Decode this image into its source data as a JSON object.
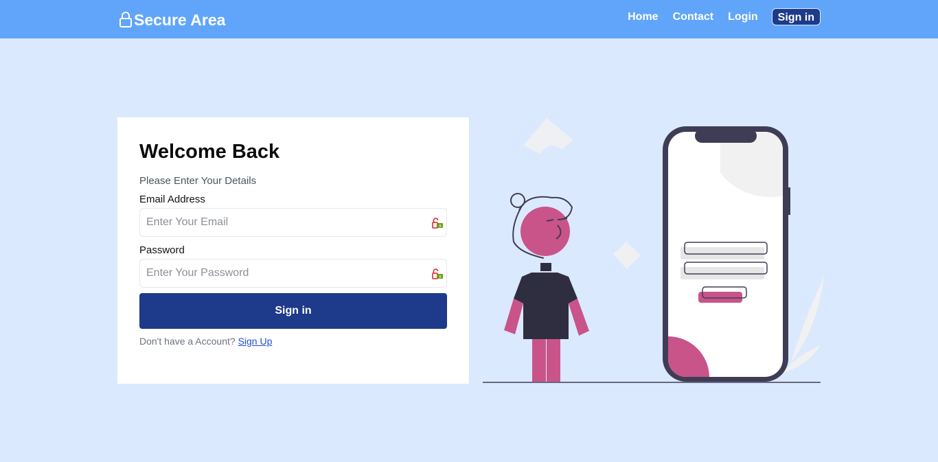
{
  "header": {
    "brand": "Secure Area",
    "nav": [
      "Home",
      "Contact",
      "Login"
    ],
    "cta": "Sign in"
  },
  "form": {
    "title": "Welcome Back",
    "subtitle": "Please Enter Your Details",
    "email": {
      "label": "Email Address",
      "placeholder": "Enter Your Email",
      "value": ""
    },
    "password": {
      "label": "Password",
      "placeholder": "Enter Your Password",
      "value": ""
    },
    "submit": "Sign in",
    "signup_prompt": "Don't have a Account?",
    "signup_link": "Sign Up"
  },
  "icons": {
    "brand": "lock-icon",
    "field_extension": "password-manager-icon"
  },
  "colors": {
    "navbar": "#60a5fa",
    "page_bg": "#dbe9fe",
    "primary": "#1e3a8a",
    "accent_pink": "#c9548a",
    "dark": "#3f3d56"
  }
}
